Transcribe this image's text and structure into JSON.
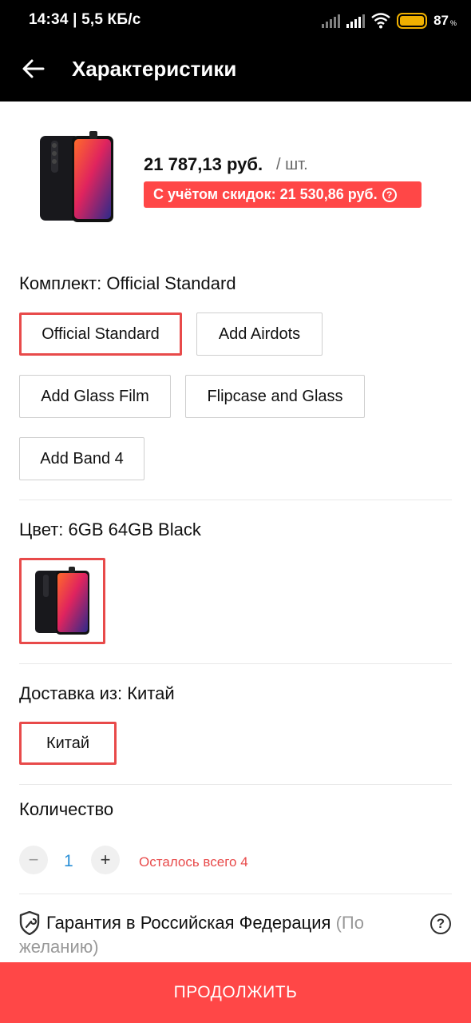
{
  "status_bar": {
    "time": "14:34 | 5,5 КБ/с",
    "battery_level": "87",
    "battery_unit": "%",
    "icons": [
      "signal-icon",
      "signal-icon",
      "wifi-icon",
      "battery-icon"
    ]
  },
  "header": {
    "back_icon": "arrow-left-icon",
    "title": "Характеристики"
  },
  "product": {
    "price": "21 787,13 руб.",
    "unit": "/ шт.",
    "discount_text": "С учётом скидок: 21 530,86 руб.",
    "discount_help": "?"
  },
  "kit": {
    "title": "Комплект: Official Standard",
    "options": [
      "Official Standard",
      "Add Airdots",
      "Add Glass Film",
      "Flipcase and Glass",
      "Add Band 4"
    ],
    "selected": "Official Standard"
  },
  "color": {
    "title": "Цвет: 6GB 64GB Black"
  },
  "shipping": {
    "title": "Доставка из: Китай",
    "options": [
      "Китай"
    ],
    "selected": "Китай"
  },
  "quantity": {
    "title": "Количество",
    "minus": "−",
    "plus": "+",
    "value": "1",
    "stock": "Осталось всего 4"
  },
  "warranty": {
    "text": "Гарантия в Российская Федерация",
    "muted": "(По желанию)",
    "help": "?"
  },
  "footer": {
    "continue_label": "ПРОДОЛЖИТЬ"
  },
  "colors": {
    "accent": "#ff4747",
    "selected_border": "#e84a4a",
    "qty_blue": "#2a8fd6"
  }
}
